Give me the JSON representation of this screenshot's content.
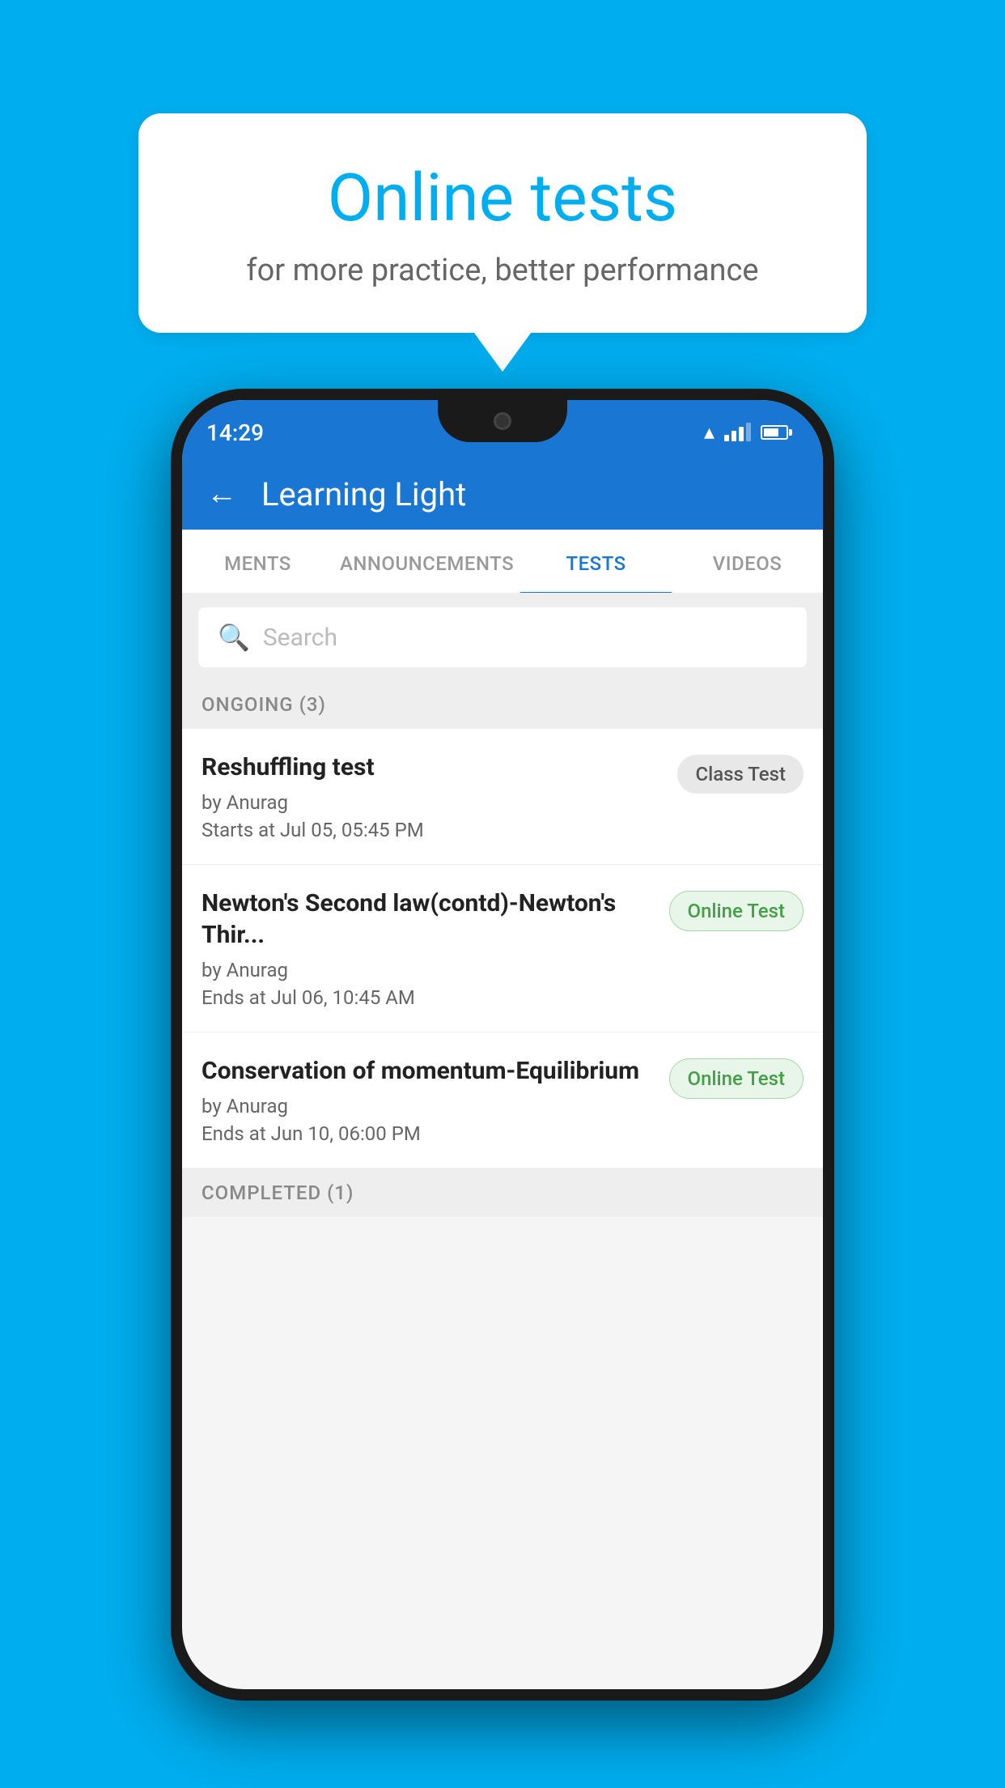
{
  "background": {
    "color": "#00AEEF"
  },
  "speech_bubble": {
    "title": "Online tests",
    "subtitle": "for more practice, better performance"
  },
  "status_bar": {
    "time": "14:29"
  },
  "app_header": {
    "title": "Learning Light",
    "back_label": "←"
  },
  "tabs": [
    {
      "label": "MENTS",
      "active": false
    },
    {
      "label": "ANNOUNCEMENTS",
      "active": false
    },
    {
      "label": "TESTS",
      "active": true
    },
    {
      "label": "VIDEOS",
      "active": false
    }
  ],
  "search": {
    "placeholder": "Search"
  },
  "ongoing_section": {
    "header": "ONGOING (3)"
  },
  "tests": [
    {
      "name": "Reshuffling test",
      "author": "by Anurag",
      "time_label": "Starts at",
      "time": "Jul 05, 05:45 PM",
      "badge": "Class Test",
      "badge_type": "class"
    },
    {
      "name": "Newton's Second law(contd)-Newton's Thir...",
      "author": "by Anurag",
      "time_label": "Ends at",
      "time": "Jul 06, 10:45 AM",
      "badge": "Online Test",
      "badge_type": "online"
    },
    {
      "name": "Conservation of momentum-Equilibrium",
      "author": "by Anurag",
      "time_label": "Ends at",
      "time": "Jun 10, 06:00 PM",
      "badge": "Online Test",
      "badge_type": "online"
    }
  ],
  "completed_section": {
    "header": "COMPLETED (1)"
  }
}
